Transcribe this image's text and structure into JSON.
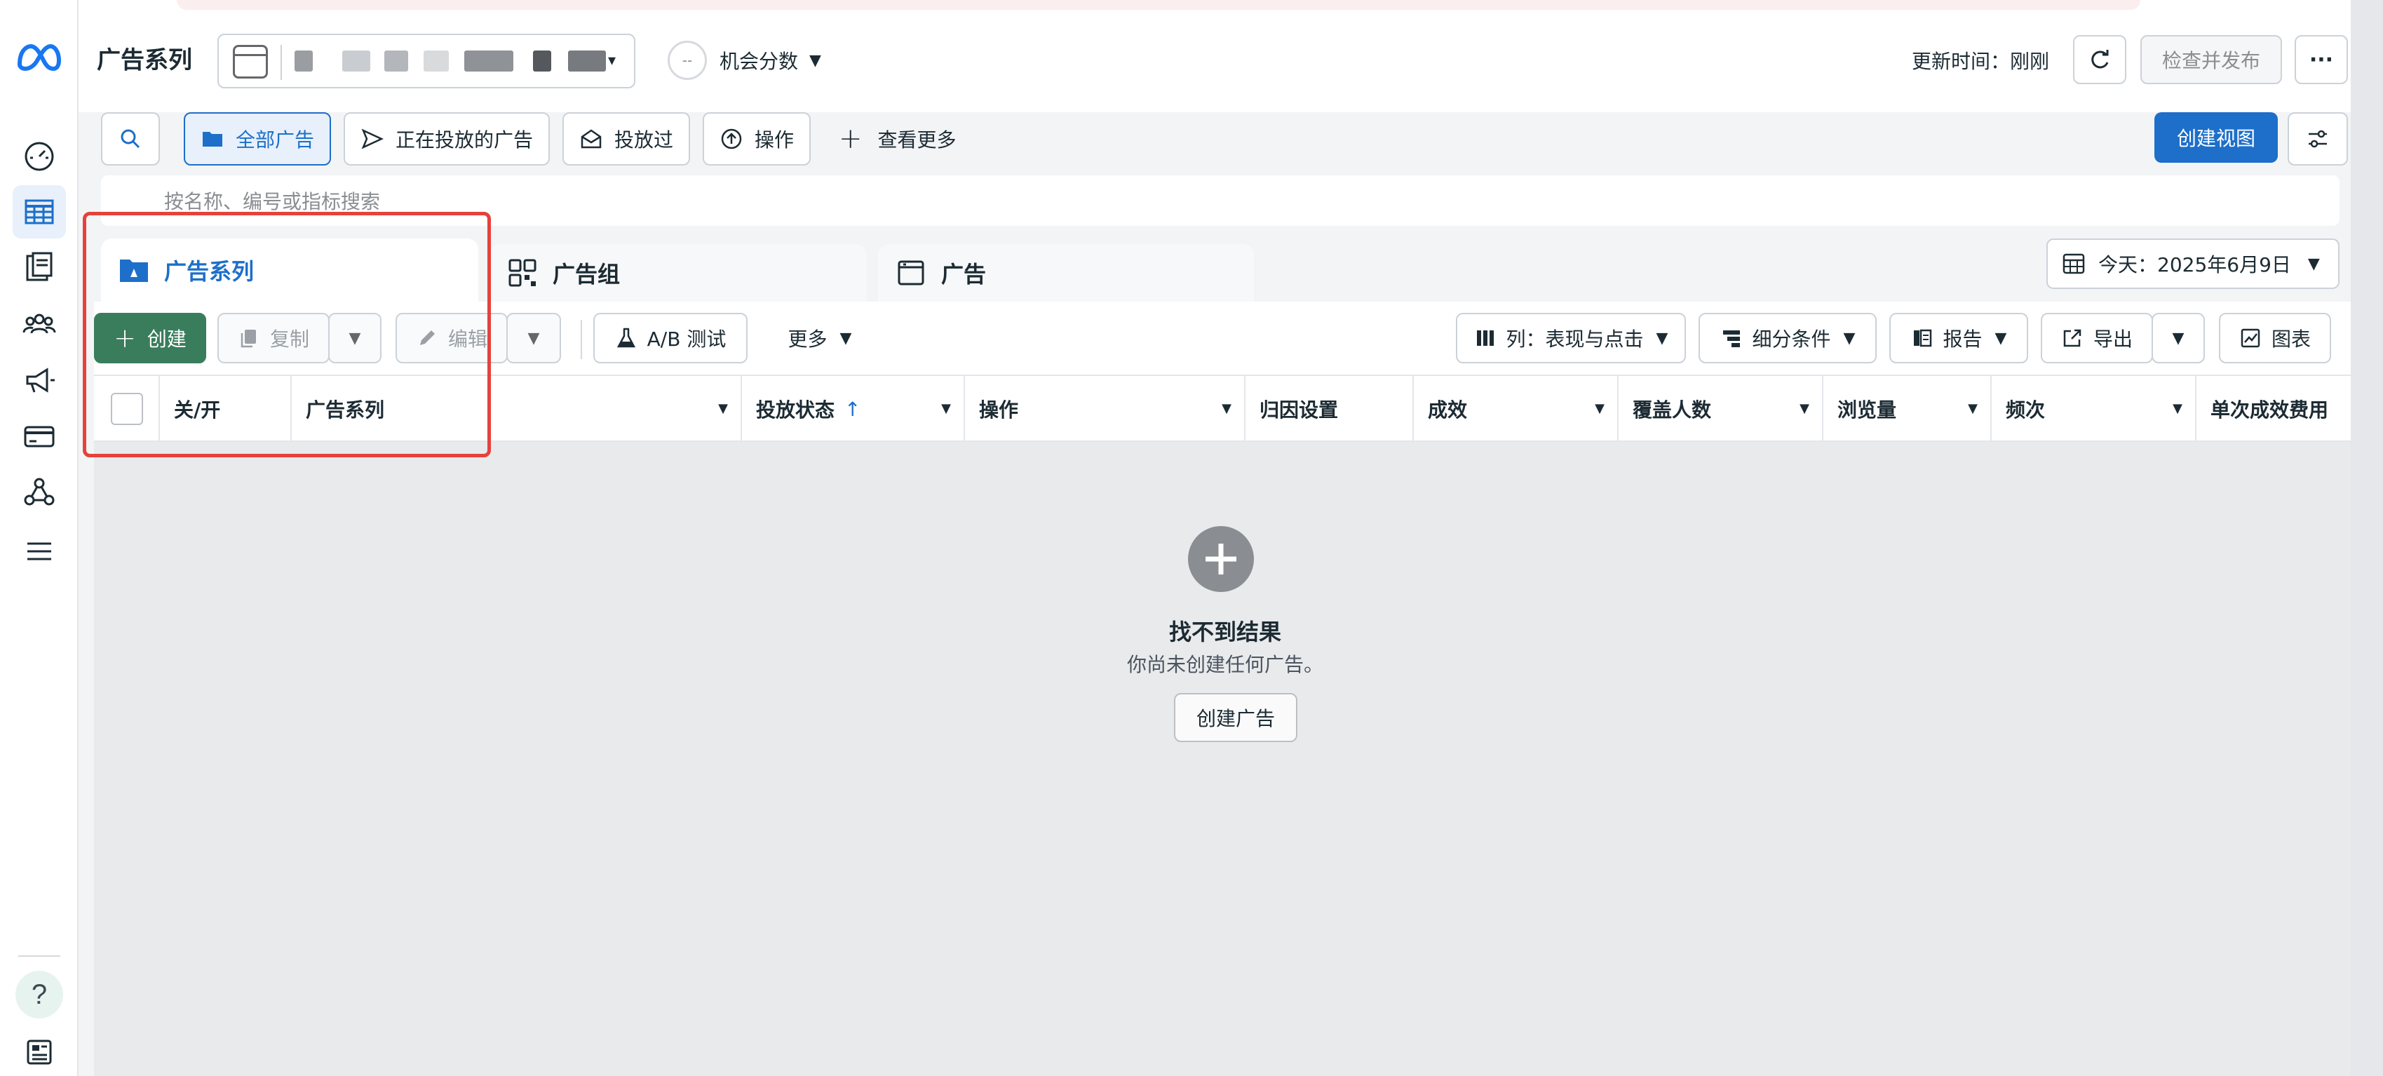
{
  "header": {
    "page_title": "广告系列",
    "opportunity_score": {
      "value": "--",
      "label": "机会分数"
    },
    "update_label": "更新时间：刚刚",
    "publish_label": "检查并发布",
    "more_label": "···"
  },
  "filters": {
    "all_ads": "全部广告",
    "active_ads": "正在投放的广告",
    "delivered": "投放过",
    "actions": "操作",
    "see_more": "查看更多",
    "create_view": "创建视图"
  },
  "search": {
    "placeholder": "按名称、编号或指标搜索"
  },
  "tabs": [
    {
      "label": "广告系列"
    },
    {
      "label": "广告组"
    },
    {
      "label": "广告"
    }
  ],
  "date_range": "今天：2025年6月9日",
  "toolbar": {
    "create": "创建",
    "duplicate": "复制",
    "edit": "编辑",
    "ab_test": "A/B 测试",
    "more": "更多",
    "columns": "列：表现与点击",
    "breakdown": "细分条件",
    "reports": "报告",
    "export": "导出",
    "charts": "图表"
  },
  "table": {
    "columns": [
      "关/开",
      "广告系列",
      "投放状态",
      "操作",
      "归因设置",
      "成效",
      "覆盖人数",
      "浏览量",
      "频次",
      "单次成效费用"
    ],
    "sort_arrow": "↑"
  },
  "empty_state": {
    "title": "找不到结果",
    "subtitle": "你尚未创建任何广告。",
    "button": "创建广告"
  },
  "colors": {
    "accent": "#1d6fc9",
    "create_green": "#3a7d5c",
    "highlight_red": "#e5423b"
  }
}
